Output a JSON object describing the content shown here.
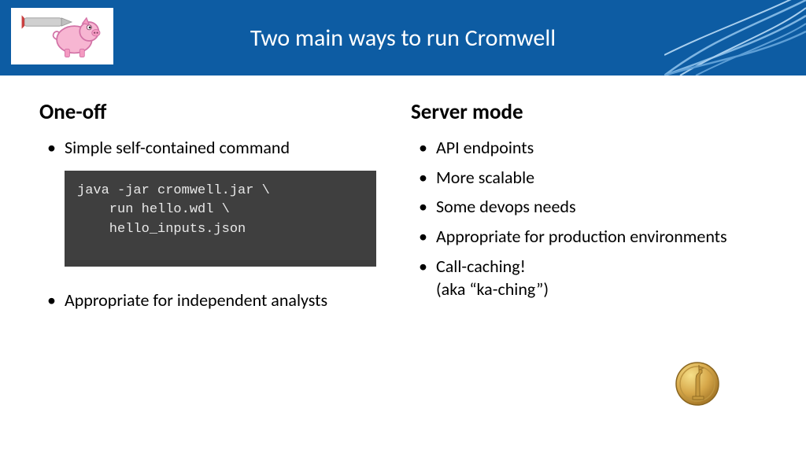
{
  "header": {
    "title": "Two main ways to run Cromwell",
    "logo_alt": "Cromwell flying pig logo"
  },
  "left": {
    "heading": "One-off",
    "bullet1": "Simple self-contained command",
    "code": "java -jar cromwell.jar \\\n    run hello.wdl \\\n    hello_inputs.json",
    "bullet2": "Appropriate for independent analysts"
  },
  "right": {
    "heading": "Server mode",
    "bullets": [
      "API endpoints",
      "More scalable",
      "Some devops needs",
      "Appropriate for production environments",
      "Call-caching!\n(aka “ka-ching”)"
    ],
    "coin_alt": "gold dollar coin"
  }
}
